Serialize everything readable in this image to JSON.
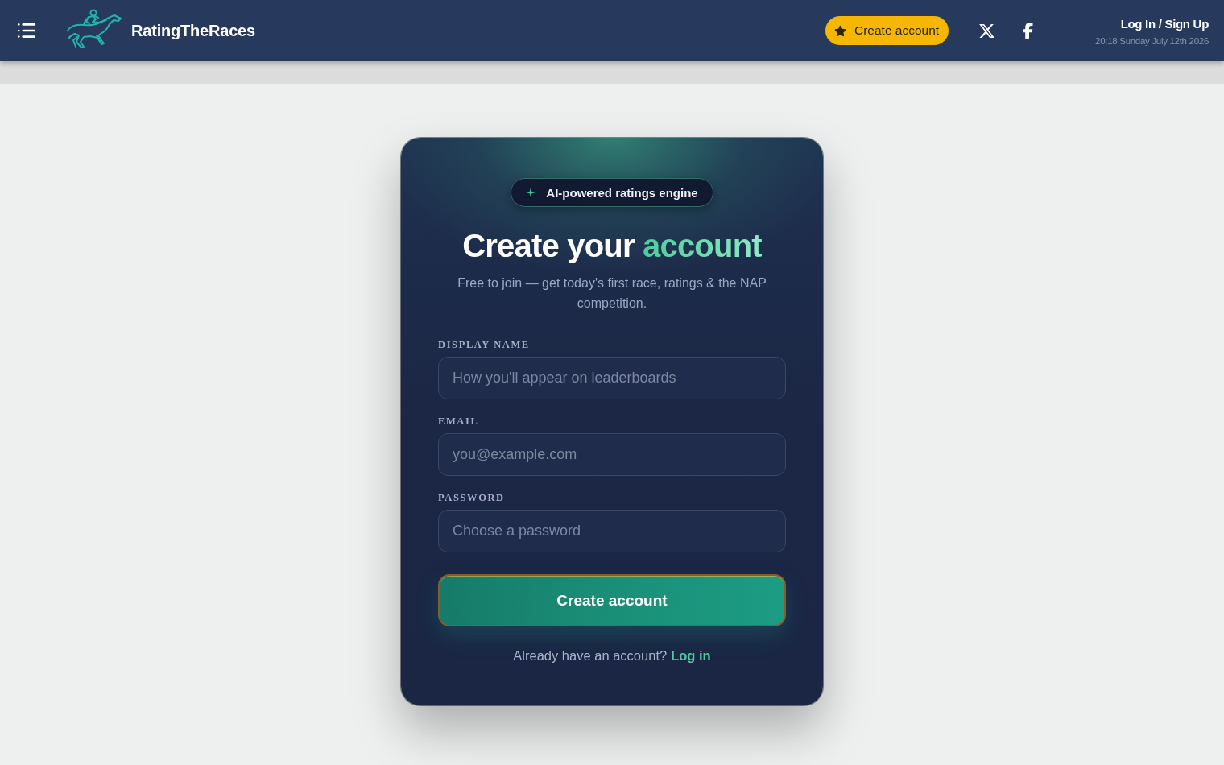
{
  "header": {
    "brand": "RatingTheRaces",
    "cta": "Create account",
    "auth_link": "Log In / Sign Up",
    "datetime": "20:18 Sunday July 12th 2026"
  },
  "card": {
    "badge": "AI-powered ratings engine",
    "title": "Create your",
    "title_accent": "account",
    "subtitle": "Free to join — get today's first race, ratings & the NAP competition.",
    "fields": [
      {
        "label": "DISPLAY NAME",
        "placeholder": "How you'll appear on leaderboards"
      },
      {
        "label": "EMAIL",
        "placeholder": "you@example.com"
      },
      {
        "label": "PASSWORD",
        "placeholder": "Choose a password"
      }
    ],
    "submit": "Create account",
    "footer": {
      "text": "Already have an account?",
      "link": "Log in"
    }
  }
}
